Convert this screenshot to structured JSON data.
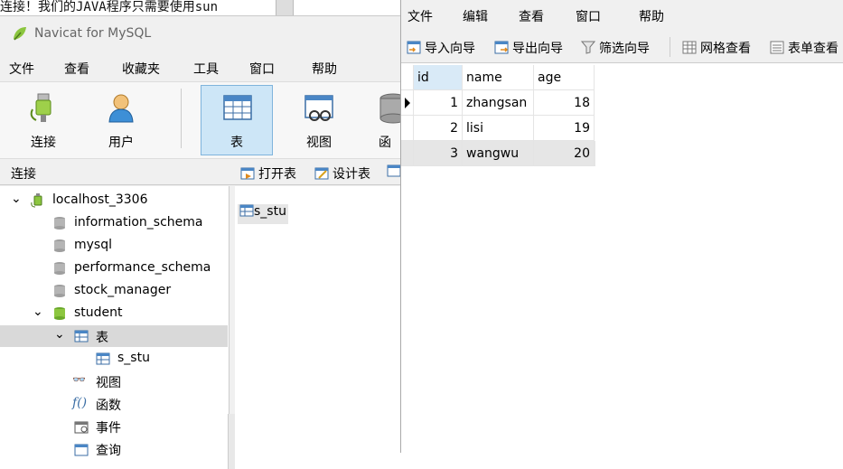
{
  "background_text": "连接！我们的JAVA程序只需要使用sun",
  "navicat": {
    "title": "Navicat for MySQL",
    "menu": [
      "文件",
      "查看",
      "收藏夹",
      "工具",
      "窗口",
      "帮助"
    ],
    "toolbar": {
      "connect": "连接",
      "user": "用户",
      "table": "表",
      "view": "视图",
      "function": "函"
    },
    "connection_header": "连接",
    "object_toolbar": {
      "open_table": "打开表",
      "design_table": "设计表"
    },
    "tree": {
      "connection": "localhost_3306",
      "databases": [
        "information_schema",
        "mysql",
        "performance_schema",
        "stock_manager"
      ],
      "open_db": "student",
      "tables_node": "表",
      "table": "s_stu",
      "view_node": "视图",
      "function_node": "函数",
      "event_node": "事件",
      "query_node": "查询"
    },
    "object_list": [
      "s_stu"
    ]
  },
  "data_window": {
    "menu": [
      "文件",
      "编辑",
      "查看",
      "窗口",
      "帮助"
    ],
    "toolbar": {
      "import_wizard": "导入向导",
      "export_wizard": "导出向导",
      "filter_wizard": "筛选向导",
      "grid_view": "网格查看",
      "form_view": "表单查看"
    },
    "columns": [
      "id",
      "name",
      "age"
    ],
    "rows": [
      {
        "id": "1",
        "name": "zhangsan",
        "age": "18"
      },
      {
        "id": "2",
        "name": "lisi",
        "age": "19"
      },
      {
        "id": "3",
        "name": "wangwu",
        "age": "20"
      }
    ]
  },
  "colors": {
    "selection": "#cde6f7",
    "tree_selection": "#d9d9d9",
    "db_icon_open": "#8cc63f",
    "db_icon_closed": "#9e9e9e"
  }
}
